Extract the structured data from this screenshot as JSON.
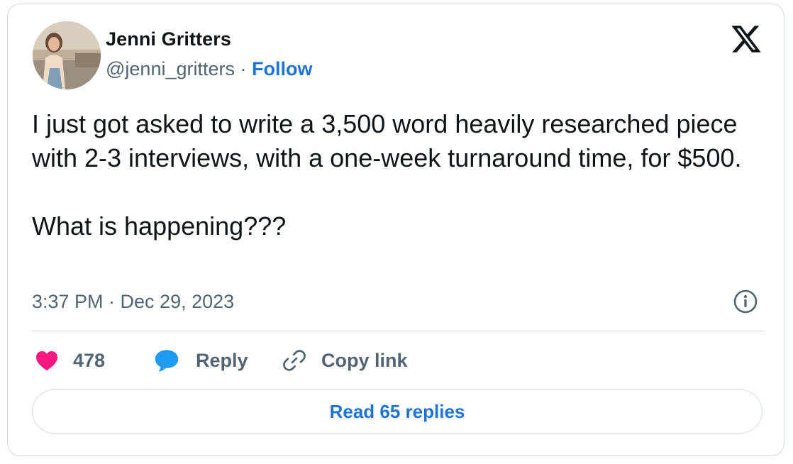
{
  "author": {
    "display_name": "Jenni Gritters",
    "handle": "@jenni_gritters",
    "separator": "·",
    "follow_label": "Follow"
  },
  "tweet": {
    "paragraphs": [
      "I just got asked to write a 3,500 word heavily researched piece with 2-3 interviews, with a one-week turnaround time, for $500.",
      "What is happening???"
    ],
    "timestamp": "3:37 PM · Dec 29, 2023"
  },
  "actions": {
    "like_count": "478",
    "reply_label": "Reply",
    "copy_link_label": "Copy link"
  },
  "read_replies_label": "Read 65 replies",
  "icons": {
    "brand": "x-logo-icon",
    "info": "info-icon",
    "like": "heart-icon",
    "reply": "speech-bubble-icon",
    "copy": "link-icon"
  },
  "colors": {
    "like": "#f91880",
    "reply": "#1d9bf0",
    "link": "#1d74d6",
    "secondary_text": "#536471",
    "primary_text": "#0f1419",
    "border": "#cfd9de"
  }
}
